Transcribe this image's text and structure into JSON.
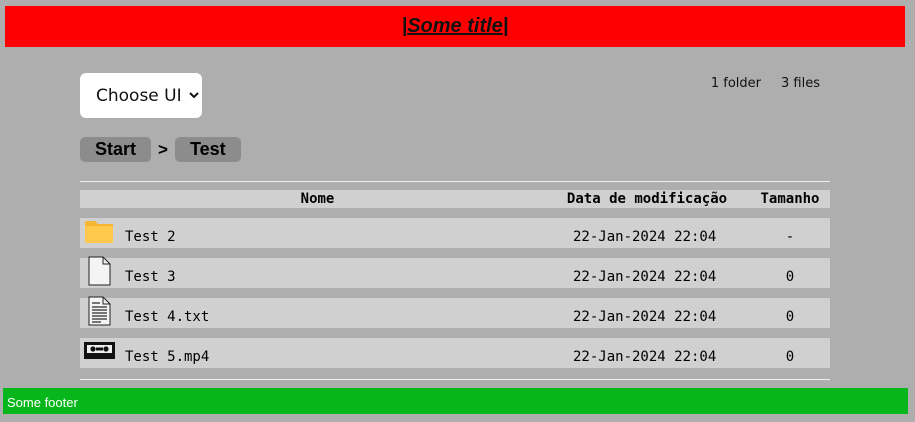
{
  "header": {
    "title_prefix": "|",
    "title": "Some title",
    "title_suffix": "|"
  },
  "ui_select": {
    "selected": "Choose UI",
    "options": [
      "Choose UI"
    ]
  },
  "counts": {
    "folders": "1 folder",
    "files": "3 files"
  },
  "breadcrumb": {
    "items": [
      "Start",
      "Test"
    ],
    "separator": ">"
  },
  "table": {
    "headers": {
      "name": "Nome",
      "date": "Data de modificação",
      "size": "Tamanho"
    },
    "rows": [
      {
        "icon": "folder-icon",
        "name": "Test 2",
        "date": "22-Jan-2024 22:04",
        "size": "-"
      },
      {
        "icon": "file-icon",
        "name": "Test 3",
        "date": "22-Jan-2024 22:04",
        "size": "0"
      },
      {
        "icon": "text-file-icon",
        "name": "Test 4.txt",
        "date": "22-Jan-2024 22:04",
        "size": "0"
      },
      {
        "icon": "video-cassette-icon",
        "name": "Test 5.mp4",
        "date": "22-Jan-2024 22:04",
        "size": "0"
      }
    ]
  },
  "footer": {
    "text": "Some footer"
  },
  "colors": {
    "header_bg": "#ff0000",
    "footer_bg": "#07b61a",
    "page_bg": "#aeaeae",
    "row_bg": "#d0d0d0"
  }
}
